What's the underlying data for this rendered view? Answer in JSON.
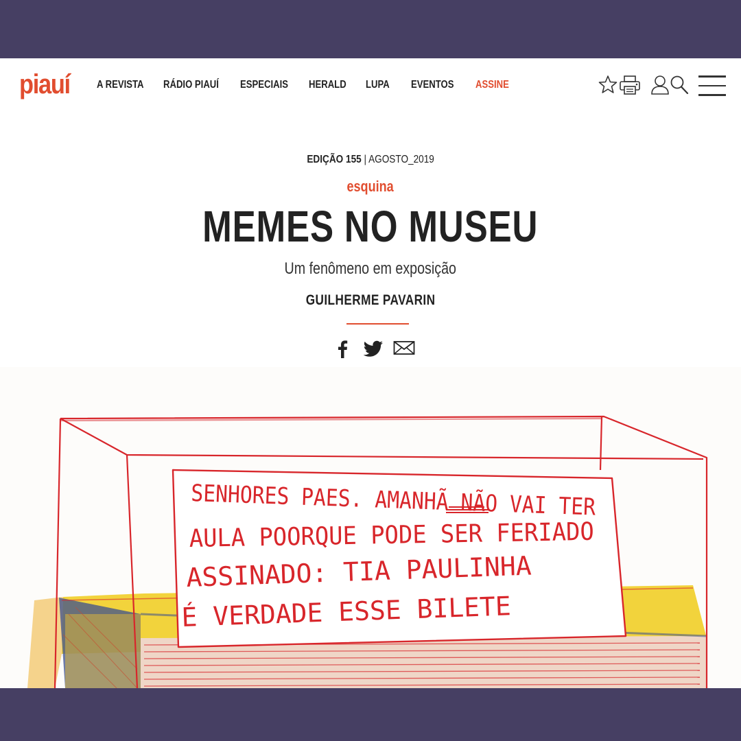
{
  "header": {
    "logo": "piauí",
    "nav": [
      "A REVISTA",
      "RÁDIO PIAUÍ",
      "ESPECIAIS",
      "HERALD",
      "LUPA",
      "EVENTOS",
      "ASSINE"
    ],
    "icons": [
      "star-icon",
      "print-icon",
      "user-icon",
      "search-icon",
      "menu-icon"
    ]
  },
  "article": {
    "edition": "EDIÇÃO 155",
    "date": "| AGOSTO_2019",
    "section": "esquina",
    "title": "MEMES NO MUSEU",
    "subtitle": "Um fenômeno em exposição",
    "author": "GUILHERME PAVARIN"
  },
  "share": [
    "facebook-icon",
    "twitter-icon",
    "email-icon"
  ],
  "illustration": {
    "note_lines": [
      "SENHORES PAES. AMANHÃ NÃO VAI TER",
      "AULA POORQUE PODE SER FERIADO",
      "ASSINADO: TIA PAULINHA",
      "É VERDADE ESSE BILETE"
    ]
  },
  "colors": {
    "frame": "#463f63",
    "accent": "#e14d2f",
    "pencil_red": "#d8262b",
    "plinth_yellow": "#f1d23a"
  }
}
